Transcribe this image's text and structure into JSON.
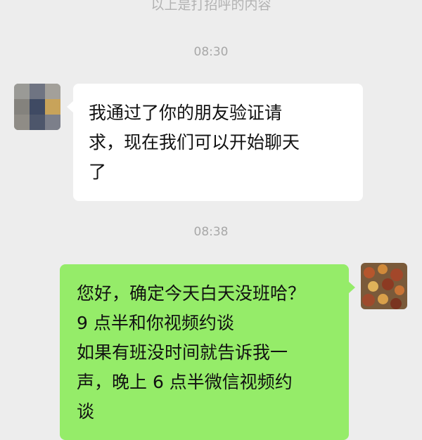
{
  "chat": {
    "system_notice": "以上是打招呼的内容",
    "messages": [
      {
        "time": "08:30",
        "sender": "contact",
        "lines": [
          "我通过了你的朋友验证请",
          "求，现在我们可以开始聊天",
          "了"
        ]
      },
      {
        "time": "08:38",
        "sender": "me",
        "lines": [
          "您好，确定今天白天没班哈？",
          "9 点半和你视频约谈",
          "如果有班没时间就告诉我一",
          "声，晚上 6 点半微信视频约",
          "谈"
        ]
      }
    ]
  },
  "colors": {
    "background": "#ededed",
    "incoming_bubble": "#ffffff",
    "outgoing_bubble": "#95ec69",
    "timestamp_text": "#a8a8a8"
  },
  "icons": {
    "contact_avatar": "pixelated-avatar-icon",
    "my_avatar": "photo-avatar-icon"
  }
}
